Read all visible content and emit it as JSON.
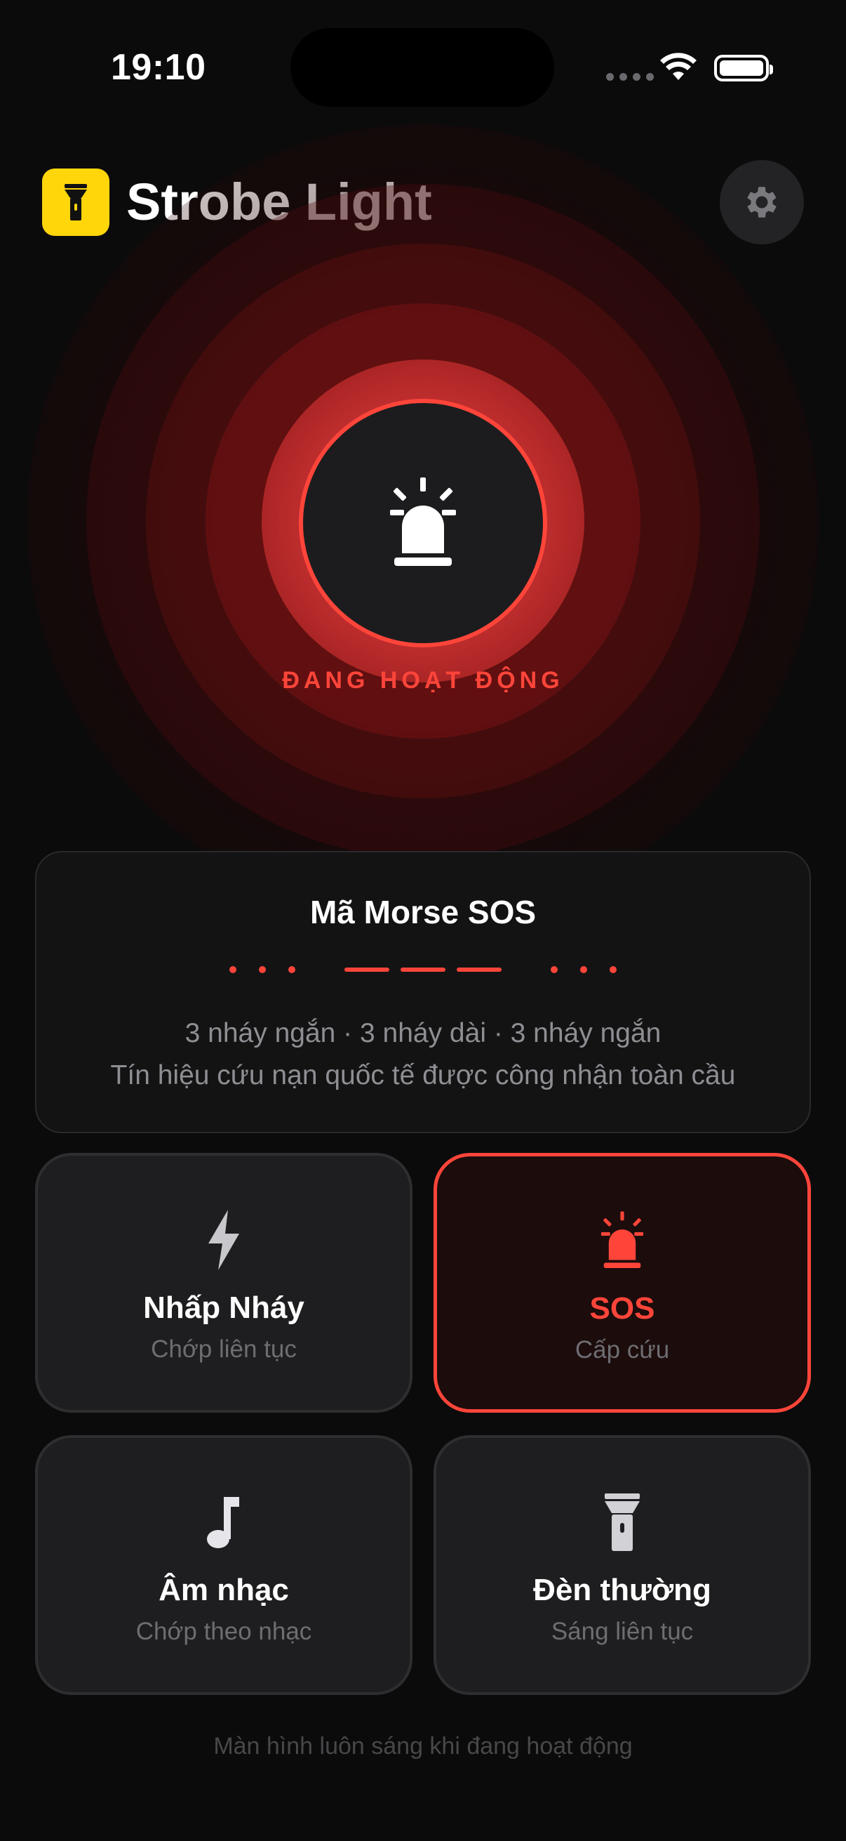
{
  "status_bar": {
    "time": "19:10"
  },
  "header": {
    "app_title": "Strobe Light"
  },
  "hero": {
    "status_label": "ĐANG HOẠT ĐỘNG"
  },
  "morse_card": {
    "title": "Mã Morse SOS",
    "pattern_line": "3 nháy ngắn · 3 nháy dài · 3 nháy ngắn",
    "description": "Tín hiệu cứu nạn quốc tế được công nhận toàn cầu"
  },
  "modes": [
    {
      "title": "Nhấp Nháy",
      "subtitle": "Chớp liên tục",
      "icon": "bolt-icon",
      "active": false
    },
    {
      "title": "SOS",
      "subtitle": "Cấp cứu",
      "icon": "siren-icon",
      "active": true
    },
    {
      "title": "Âm nhạc",
      "subtitle": "Chớp theo nhạc",
      "icon": "music-note-icon",
      "active": false
    },
    {
      "title": "Đèn thường",
      "subtitle": "Sáng liên tục",
      "icon": "flashlight-icon",
      "active": false
    }
  ],
  "footer": {
    "note": "Màn hình luôn sáng khi đang hoạt động"
  },
  "colors": {
    "accent": "#ff453a",
    "brand": "#ffd60a",
    "background": "#0b0b0c"
  }
}
